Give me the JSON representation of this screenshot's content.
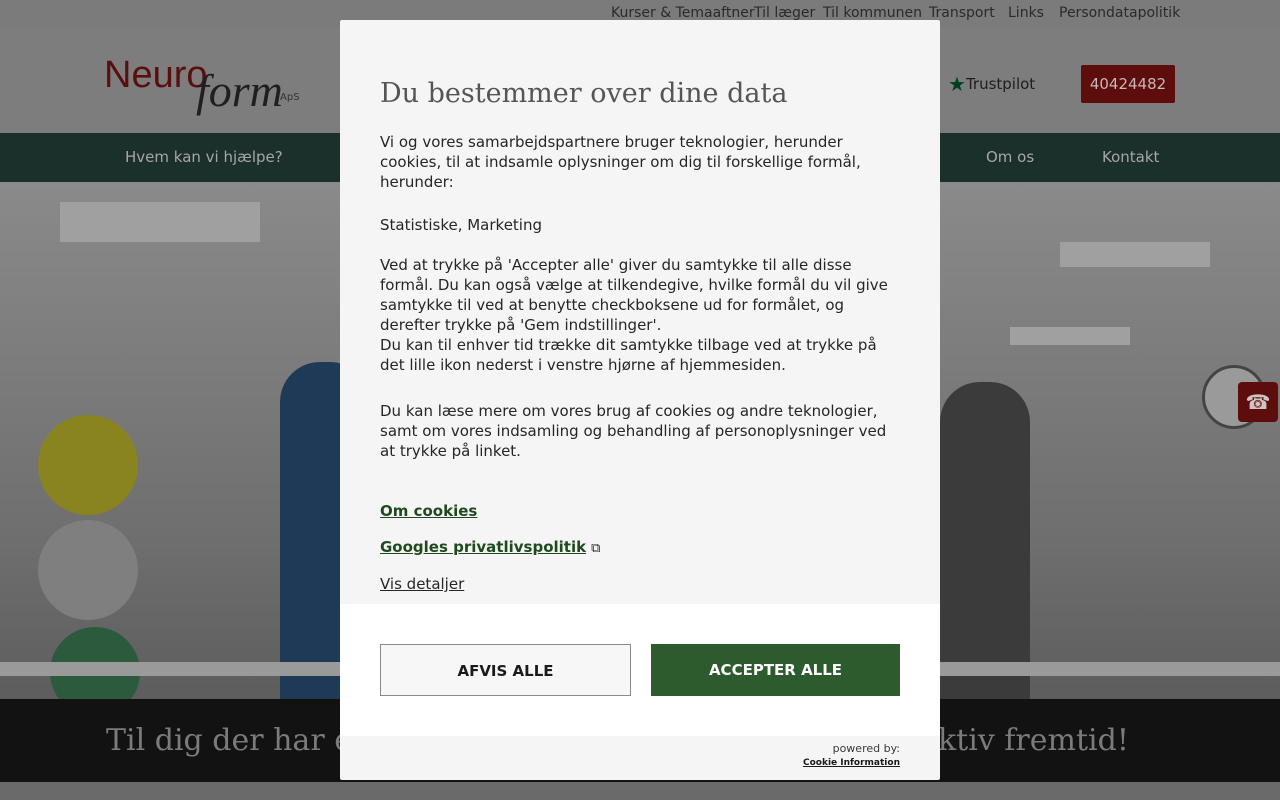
{
  "top_links": [
    "Kurser & Temaaftner",
    "Til læger",
    "Til kommunen",
    "Transport",
    "Links",
    "Persondatapolitik"
  ],
  "logo": {
    "neuro": "Neuro",
    "form": "form",
    "aps": "ApS"
  },
  "trustpilot": {
    "label": "Trustpilot",
    "icon": "star-icon"
  },
  "phone_number": "40424482",
  "nav": [
    "Hvem kan vi hjælpe?",
    "Om os",
    "Kontakt"
  ],
  "hero": {
    "tagline_left": "Til dig der har en",
    "tagline_right": "ktiv fremtid!"
  },
  "modal": {
    "title": "Du bestemmer over dine data",
    "intro": "Vi og vores samarbejdspartnere bruger teknologier, herunder cookies, til at indsamle oplysninger om dig til forskellige formål, herunder:",
    "purposes": "Statistiske, Marketing",
    "consent_text": "Ved at trykke på 'Accepter alle' giver du samtykke til alle disse formål. Du kan også vælge at tilkendegive, hvilke formål du vil give samtykke til ved at benytte checkboksene ud for formålet, og derefter trykke på 'Gem indstillinger'.",
    "withdraw_text": "Du kan til enhver tid trække dit samtykke tilbage ved at trykke på det lille ikon nederst i venstre hjørne af hjemmesiden.",
    "more_text": "Du kan læse mere om vores brug af cookies og andre teknologier, samt om vores indsamling og behandling af personoplysninger ved at trykke på linket.",
    "link_cookies": "Om cookies",
    "link_google": "Googles privatlivspolitik",
    "link_details": "Vis detaljer",
    "reject_label": "AFVIS ALLE",
    "accept_label": "ACCEPTER ALLE",
    "powered_by": "powered by:",
    "provider": "Cookie Information"
  },
  "colors": {
    "accept_green": "#2d5b2d",
    "phone_red": "#5e0d0d",
    "nav_dark": "#1b2f2b",
    "link_green": "#1f4a1f"
  }
}
